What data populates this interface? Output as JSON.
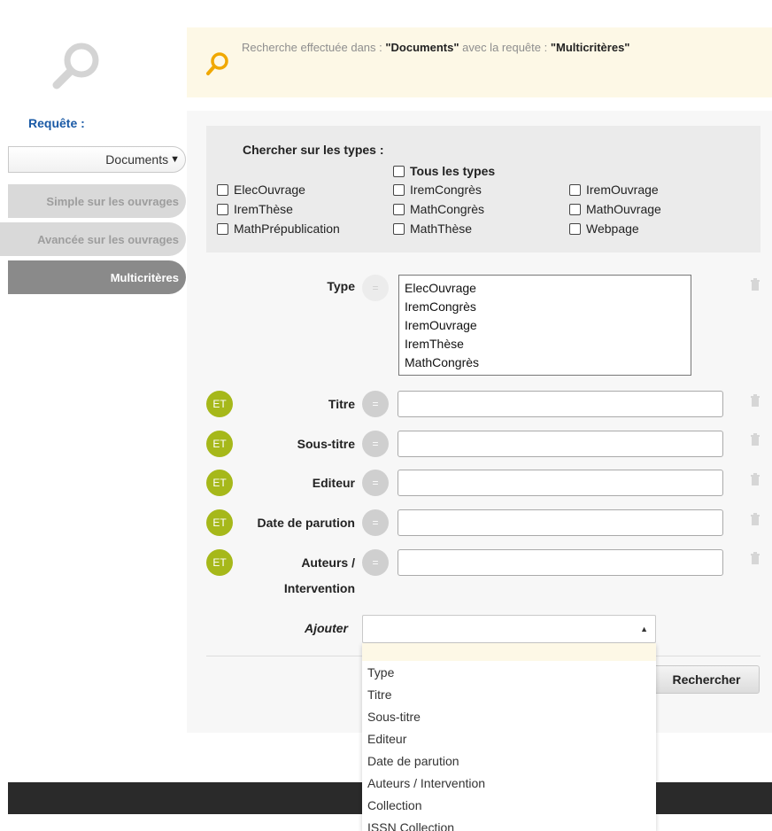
{
  "sidebar": {
    "requete_label": "Requête :",
    "doc_select_value": "Documents",
    "items": [
      {
        "label": "Simple sur les ouvrages",
        "active": false
      },
      {
        "label": "Avancée sur les ouvrages",
        "active": false
      },
      {
        "label": "Multicritères",
        "active": true
      }
    ]
  },
  "banner": {
    "prefix": "Recherche effectuée dans : ",
    "scope": "\"Documents\"",
    "middle": " avec la requête : ",
    "query": "\"Multicritères\""
  },
  "types": {
    "title": "Chercher sur les types :",
    "all_label": "Tous les types",
    "options": [
      "ElecOuvrage",
      "IremCongrès",
      "IremOuvrage",
      "IremThèse",
      "MathCongrès",
      "MathOuvrage",
      "MathPrépublication",
      "MathThèse",
      "Webpage"
    ]
  },
  "criteria": {
    "type_label": "Type",
    "type_list": [
      "ElecOuvrage",
      "IremCongrès",
      "IremOuvrage",
      "IremThèse",
      "MathCongrès"
    ],
    "et_label": "ET",
    "eq_label": "=",
    "fields": [
      {
        "label": "Titre",
        "value": ""
      },
      {
        "label": "Sous-titre",
        "value": ""
      },
      {
        "label": "Editeur",
        "value": ""
      },
      {
        "label": "Date de parution",
        "value": ""
      },
      {
        "label": "Auteurs /",
        "label2": "Intervention",
        "value": ""
      }
    ]
  },
  "ajouter": {
    "label": "Ajouter",
    "selected": "",
    "options": [
      "Type",
      "Titre",
      "Sous-titre",
      "Editeur",
      "Date de parution",
      "Auteurs / Intervention",
      "Collection",
      "ISSN Collection"
    ]
  },
  "search_button": "Rechercher",
  "colors": {
    "accent_blue": "#1a5aa6",
    "et_green": "#a6b81a",
    "banner_bg": "#fdf8e6",
    "search_icon": "#f0a800"
  }
}
